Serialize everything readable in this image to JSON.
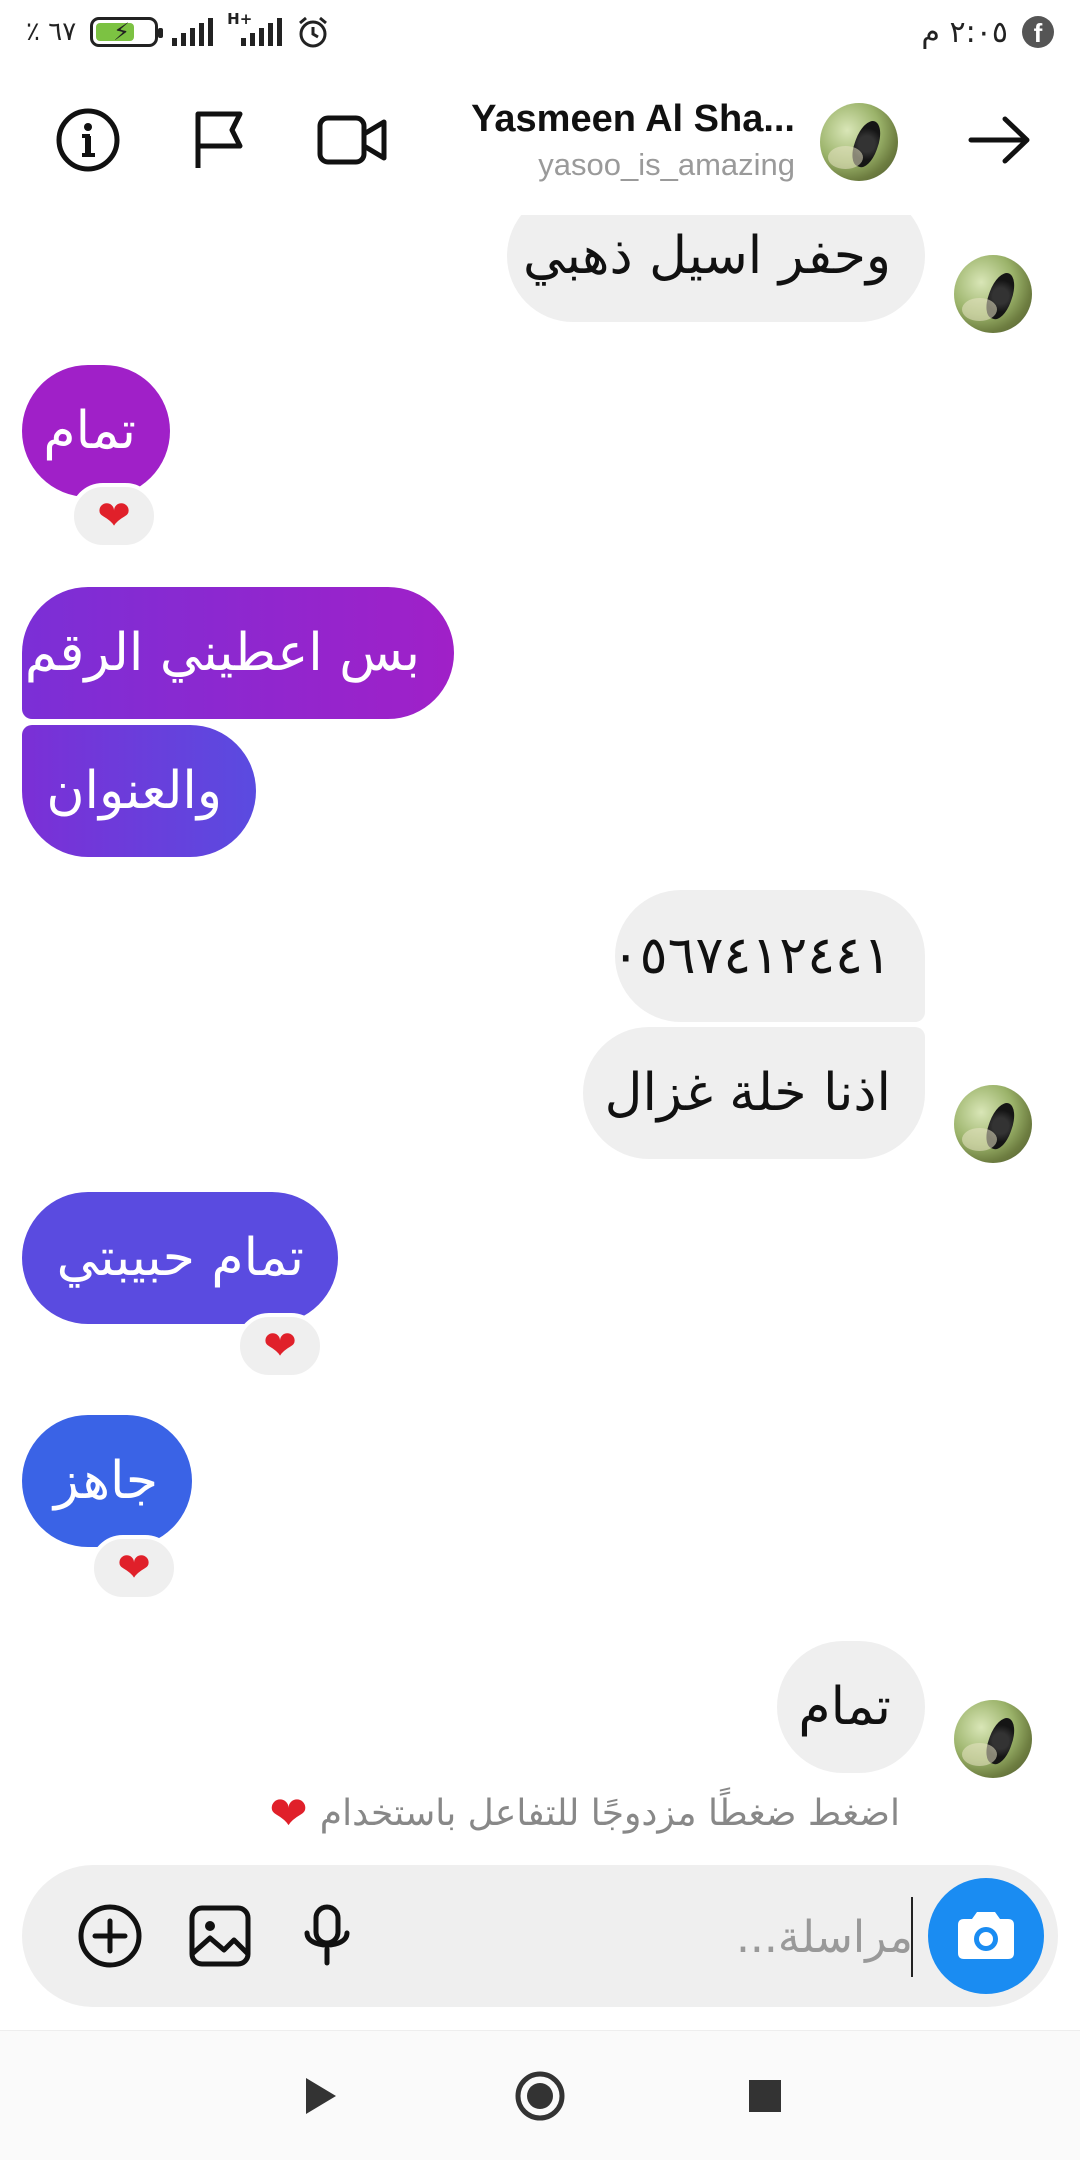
{
  "status_bar": {
    "time": "٢:٠٥ م",
    "battery_percent": "٦٧ ٪",
    "battery_level": 0.67,
    "network_type": "H+",
    "icons": [
      "facebook-icon",
      "alarm-icon",
      "signal-icon",
      "battery-charging-icon"
    ]
  },
  "header": {
    "title": "Yasmeen Al Sha...",
    "username": "yasoo_is_amazing",
    "icons": [
      "back-arrow-icon",
      "video-call-icon",
      "flag-icon",
      "info-icon"
    ]
  },
  "messages": [
    {
      "side": "incoming",
      "text": "وحفر اسيل ذهبي",
      "reaction": ""
    },
    {
      "side": "outgoing",
      "text": "تمام",
      "reaction": "❤️"
    },
    {
      "side": "outgoing",
      "text": "بس اعطيني الرقم",
      "reaction": ""
    },
    {
      "side": "outgoing",
      "text": "والعنوان",
      "reaction": ""
    },
    {
      "side": "incoming",
      "text": "٠٥٦٧٤١٢٤٤١",
      "reaction": ""
    },
    {
      "side": "incoming",
      "text": "اذنا خلة غزال",
      "reaction": ""
    },
    {
      "side": "outgoing",
      "text": "تمام حبيبتي",
      "reaction": "❤️"
    },
    {
      "side": "outgoing",
      "text": "جاهز",
      "reaction": "❤️"
    },
    {
      "side": "incoming",
      "text": "تمام",
      "reaction": ""
    }
  ],
  "reaction_heart": "❤",
  "hint": {
    "text": "اضغط ضغطًا مزدوجًا للتفاعل باستخدام",
    "emoji": "❤"
  },
  "composer": {
    "placeholder": "مراسلة...",
    "value": "",
    "icons": [
      "camera-icon",
      "microphone-icon",
      "gallery-icon",
      "add-icon"
    ]
  },
  "colors": {
    "incoming_bubble": "#efefef",
    "outgoing_gradient": [
      "#a020c8",
      "#7b2fd6",
      "#5a4be0",
      "#3a63e6"
    ],
    "camera_button": "#1a8cf2",
    "heart": "#e0202a"
  },
  "nav_bar": {
    "icons": [
      "back-triangle-icon",
      "home-circle-icon",
      "recents-square-icon"
    ]
  }
}
